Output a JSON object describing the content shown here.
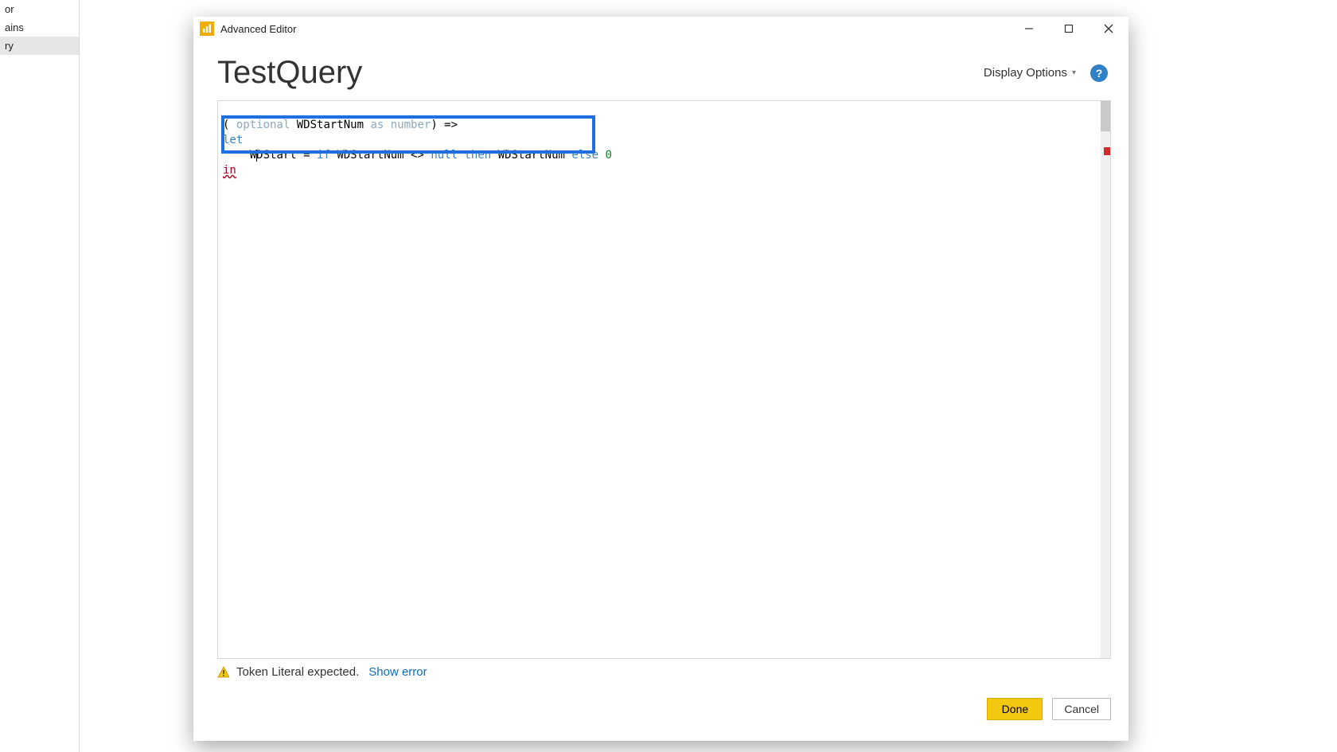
{
  "background": {
    "items": [
      "or",
      "ains",
      "ry"
    ],
    "selected_index": 2
  },
  "window": {
    "title": "Advanced Editor"
  },
  "header": {
    "query_name": "TestQuery",
    "display_options_label": "Display Options",
    "help_glyph": "?"
  },
  "code": {
    "line1_part1": "( ",
    "line1_kw1": "optional",
    "line1_ident1": " WDStartNum ",
    "line1_kw2": "as",
    "line1_kw3": " number",
    "line1_tail": ") =>",
    "line2_kw": "let",
    "line3_indent": "    ",
    "line3_id1_a": "W",
    "line3_id1_b": "DStart",
    "line3_eq": " = ",
    "line3_kw_if": "if",
    "line3_sp1": " ",
    "line3_id2": "WDStartNum",
    "line3_op": " <> ",
    "line3_kw_null": "null",
    "line3_sp2": " ",
    "line3_kw_then": "then",
    "line3_sp3": " ",
    "line3_id3": "WDStartNum",
    "line3_sp4": " ",
    "line3_kw_else": "else",
    "line3_sp5": " ",
    "line3_num": "0",
    "line4_err": "in"
  },
  "status": {
    "error_message": "Token Literal expected.",
    "show_error_label": "Show error"
  },
  "footer": {
    "done_label": "Done",
    "cancel_label": "Cancel"
  }
}
